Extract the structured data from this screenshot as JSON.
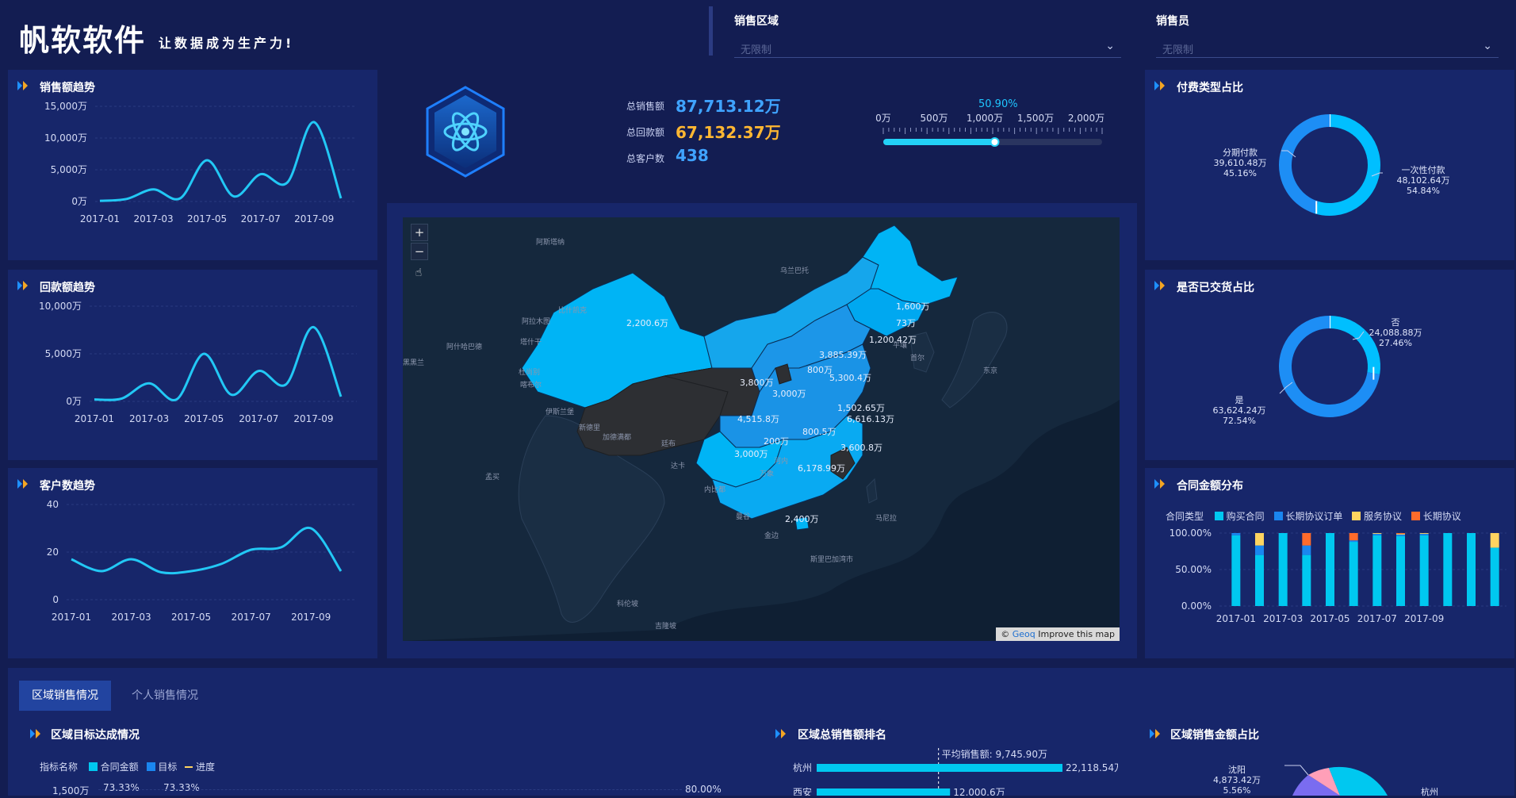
{
  "header": {
    "logo_text": "帆软软件",
    "slogan": "让数据成为生产力!",
    "filters": [
      {
        "label": "销售区域",
        "placeholder": "无限制"
      },
      {
        "label": "销售员",
        "placeholder": "无限制"
      }
    ]
  },
  "kpi": {
    "items": [
      {
        "label": "总销售额",
        "value": "87,713.12万",
        "color": "#3fa3ff"
      },
      {
        "label": "总回款额",
        "value": "67,132.37万",
        "color": "#ffb732"
      },
      {
        "label": "总客户数",
        "value": "438",
        "color": "#3fa3ff"
      }
    ],
    "progress": {
      "percent_label": "50.90%",
      "value": 0.509,
      "ticks": [
        "0万",
        "500万",
        "1,000万",
        "1,500万",
        "2,000万"
      ]
    }
  },
  "sales_trend": {
    "title": "销售额趋势",
    "chart_data": {
      "type": "line",
      "x": [
        "2017-01",
        "2017-02",
        "2017-03",
        "2017-04",
        "2017-05",
        "2017-06",
        "2017-07",
        "2017-08",
        "2017-09",
        "2017-10"
      ],
      "x_ticks": [
        "2017-01",
        "2017-03",
        "2017-05",
        "2017-07",
        "2017-09"
      ],
      "y_ticks": [
        "15,000万",
        "10,000万",
        "5,000万",
        "0万"
      ],
      "ylim": [
        0,
        15000
      ],
      "values": [
        100,
        400,
        1900,
        500,
        6500,
        800,
        4300,
        3000,
        12500,
        500
      ]
    }
  },
  "payment_trend": {
    "title": "回款额趋势",
    "chart_data": {
      "type": "line",
      "x": [
        "2017-01",
        "2017-02",
        "2017-03",
        "2017-04",
        "2017-05",
        "2017-06",
        "2017-07",
        "2017-08",
        "2017-09",
        "2017-10"
      ],
      "x_ticks": [
        "2017-01",
        "2017-03",
        "2017-05",
        "2017-07",
        "2017-09"
      ],
      "y_ticks": [
        "10,000万",
        "5,000万",
        "0万"
      ],
      "ylim": [
        0,
        10000
      ],
      "values": [
        200,
        300,
        1900,
        200,
        5000,
        700,
        3200,
        1800,
        7800,
        500
      ]
    }
  },
  "customer_trend": {
    "title": "客户数趋势",
    "chart_data": {
      "type": "line",
      "x": [
        "2017-01",
        "2017-02",
        "2017-03",
        "2017-04",
        "2017-05",
        "2017-06",
        "2017-07",
        "2017-08",
        "2017-09",
        "2017-10"
      ],
      "x_ticks": [
        "2017-01",
        "2017-03",
        "2017-05",
        "2017-07",
        "2017-09"
      ],
      "y_ticks": [
        "40",
        "20",
        "0"
      ],
      "ylim": [
        0,
        40
      ],
      "values": [
        17,
        12,
        17,
        11.5,
        12,
        15,
        21,
        22,
        30,
        12
      ]
    }
  },
  "map": {
    "zoom_in": "+",
    "zoom_out": "−",
    "attribution_prefix": "© ",
    "attribution_link": "Geoq",
    "attribution_suffix": " Improve this map",
    "labels": [
      "2,200.6万",
      "1,600万",
      "73万",
      "1,200.42万",
      "3,885.39万",
      "800万",
      "3,800万",
      "3,000万",
      "5,300.4万",
      "1,502.65万",
      "4,515.8万",
      "6,616.13万",
      "800.5万",
      "200万",
      "3,600.8万",
      "3,000万",
      "6,178.99万",
      "2,400万"
    ],
    "places": [
      "阿斯塔纳",
      "乌兰巴托",
      "比什凯克",
      "阿拉木图",
      "塔什干",
      "杜尚别",
      "阿什哈巴德",
      "喀布尔",
      "伊斯兰堡",
      "黑黑兰",
      "新德里",
      "加德满都",
      "廷布",
      "达卡",
      "新德里",
      "孟买",
      "内比都",
      "万象",
      "河内",
      "海防",
      "曼谷",
      "金边",
      "马尼拉",
      "平壤",
      "首尔",
      "东京",
      "斯里兰卡",
      "胡志明市",
      "科伦坡",
      "吉隆坡",
      "阿拉伯海",
      "孟加拉湾",
      "南海",
      "斯里巴加湾市"
    ]
  },
  "payment_type": {
    "title": "付费类型占比",
    "chart_data": {
      "type": "pie",
      "slices": [
        {
          "name": "一次性付款",
          "value_label": "48,102.64万",
          "percent_label": "54.84%",
          "value": 54.84,
          "color": "#00bfff"
        },
        {
          "name": "分期付款",
          "value_label": "39,610.48万",
          "percent_label": "45.16%",
          "value": 45.16,
          "color": "#1d8ef5"
        }
      ]
    }
  },
  "delivery": {
    "title": "是否已交货占比",
    "chart_data": {
      "type": "pie",
      "slices": [
        {
          "name": "否",
          "value_label": "24,088.88万",
          "percent_label": "27.46%",
          "value": 27.46,
          "color": "#00bfff"
        },
        {
          "name": "是",
          "value_label": "63,624.24万",
          "percent_label": "72.54%",
          "value": 72.54,
          "color": "#1d8ef5"
        }
      ]
    }
  },
  "contract_dist": {
    "title": "合同金额分布",
    "legend_title": "合同类型",
    "chart_data": {
      "type": "bar",
      "stacked": true,
      "percent": true,
      "categories": [
        "2017-01",
        "2017-02",
        "2017-03",
        "2017-04",
        "2017-05",
        "2017-06",
        "2017-07",
        "2017-08",
        "2017-09",
        "2017-10",
        "2017-11",
        "2017-12"
      ],
      "x_ticks": [
        "2017-01",
        "2017-03",
        "2017-05",
        "2017-07",
        "2017-09"
      ],
      "y_ticks": [
        "100.00%",
        "50.00%",
        "0.00%"
      ],
      "series": [
        {
          "name": "购买合同",
          "color": "#00c8f0",
          "values": [
            97,
            70,
            100,
            70,
            100,
            88,
            97,
            96,
            97,
            100,
            100,
            80
          ]
        },
        {
          "name": "长期协议订单",
          "color": "#1a86f0",
          "values": [
            3,
            13,
            0,
            13,
            0,
            2,
            2,
            2,
            2,
            0,
            0,
            0
          ]
        },
        {
          "name": "服务协议",
          "color": "#ffd460",
          "values": [
            0,
            17,
            0,
            0,
            0,
            0,
            1,
            1,
            1,
            0,
            0,
            20
          ]
        },
        {
          "name": "长期协议",
          "color": "#ff6b2b",
          "values": [
            0,
            0,
            0,
            17,
            0,
            10,
            0,
            1,
            0,
            0,
            0,
            0
          ]
        }
      ]
    }
  },
  "bottom": {
    "tabs": [
      "区域销售情况",
      "个人销售情况"
    ],
    "target": {
      "title": "区域目标达成情况",
      "legend_title": "指标名称",
      "legend": [
        "合同金额",
        "目标",
        "进度"
      ],
      "first_tick": "1,500万",
      "labels": [
        "73.33%",
        "73.33%"
      ],
      "right_tick": "80.00%"
    },
    "ranking": {
      "title": "区域总销售额排名",
      "avg_label": "平均销售额: 9,745.90万",
      "chart_data": {
        "type": "bar",
        "categories": [
          "杭州",
          "西安"
        ],
        "values": [
          22118.54,
          12000.6
        ],
        "value_labels": [
          "22,118.54万",
          "12,000.6万"
        ]
      }
    },
    "share": {
      "title": "区域销售金额占比",
      "slice_label": {
        "name": "沈阳",
        "value": "4,873.42万",
        "percent": "5.56%"
      },
      "right_label": "杭州"
    }
  }
}
